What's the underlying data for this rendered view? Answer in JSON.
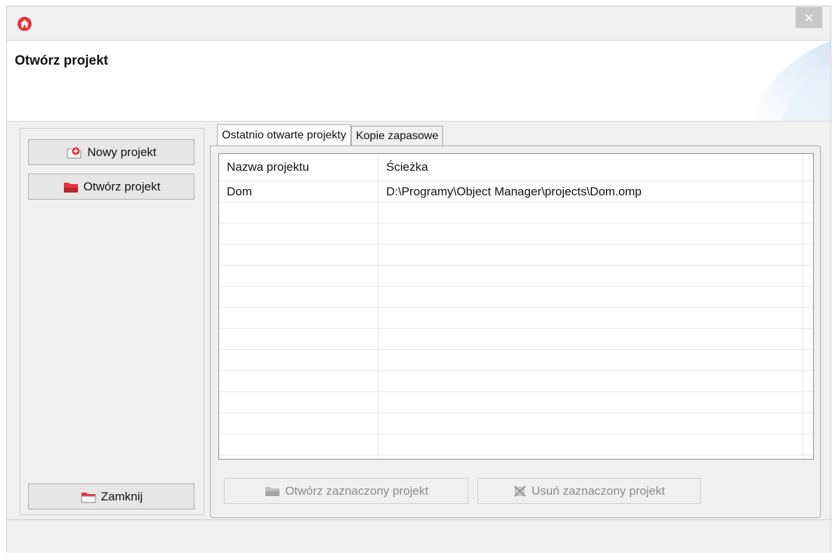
{
  "window": {
    "close_label": "×"
  },
  "header": {
    "title": "Otwórz projekt"
  },
  "left": {
    "new_project": "Nowy projekt",
    "open_project": "Otwórz projekt",
    "close": "Zamknij"
  },
  "tabs": [
    {
      "label": "Ostatnio otwarte projekty",
      "active": true
    },
    {
      "label": "Kopie zapasowe",
      "active": false
    }
  ],
  "table": {
    "columns": [
      "Nazwa projektu",
      "Ścieżka"
    ],
    "rows": [
      {
        "name": "Dom",
        "path": "D:\\Programy\\Object Manager\\projects\\Dom.omp"
      }
    ]
  },
  "actions": {
    "open_selected": "Otwórz zaznaczony projekt",
    "delete_selected": "Usuń zaznaczony projekt"
  },
  "icons": {
    "app": "home-icon",
    "new": "new-project-icon",
    "open": "open-folder-icon",
    "close": "close-folder-icon",
    "delete": "delete-icon"
  },
  "colors": {
    "accent_red": "#e8323c",
    "disabled_text": "#8a8a8a"
  }
}
